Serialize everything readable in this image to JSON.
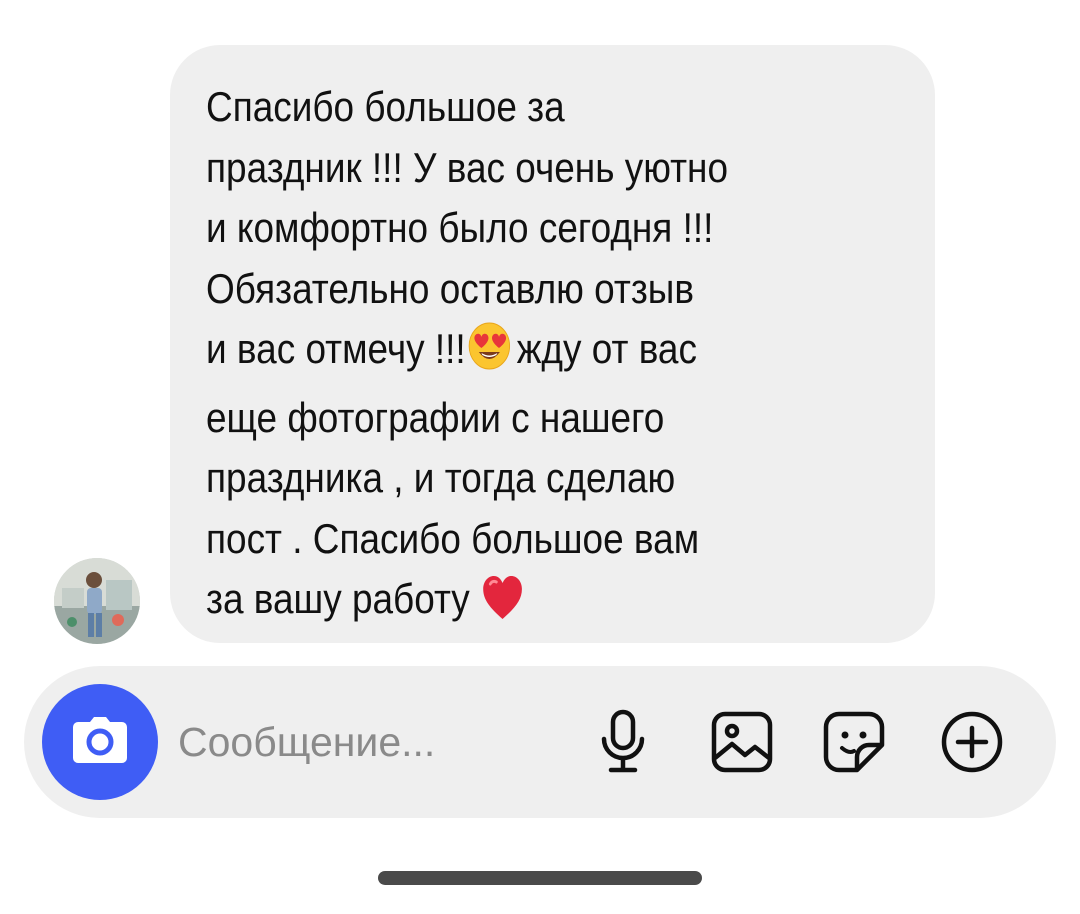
{
  "conversation": {
    "message": {
      "text_part1": "Спасибо большое за\nпраздник !!! У вас очень уютно\nи комфортно было сегодня !!!\nОбязательно оставлю отзыв\nи вас отмечу !!!",
      "text_part2": "жду от вас\nеще фотографии с нашего\nпраздника , и тогда сделаю\nпост . Спасибо большое вам\nза вашу работу ",
      "emoji_1": "smiling-face-with-heart-eyes-emoji",
      "emoji_2": "red-heart-emoji"
    },
    "sender_avatar": "photo-avatar"
  },
  "composer": {
    "placeholder": "Сообщение...",
    "value": "",
    "camera_icon": "camera-icon",
    "tools": [
      "microphone-icon",
      "gallery-icon",
      "sticker-icon",
      "plus-icon"
    ],
    "accent_color": "#3f5df5"
  },
  "colors": {
    "bubble_bg": "#efefef",
    "text": "#111111",
    "home_indicator": "#4a4a4a"
  }
}
